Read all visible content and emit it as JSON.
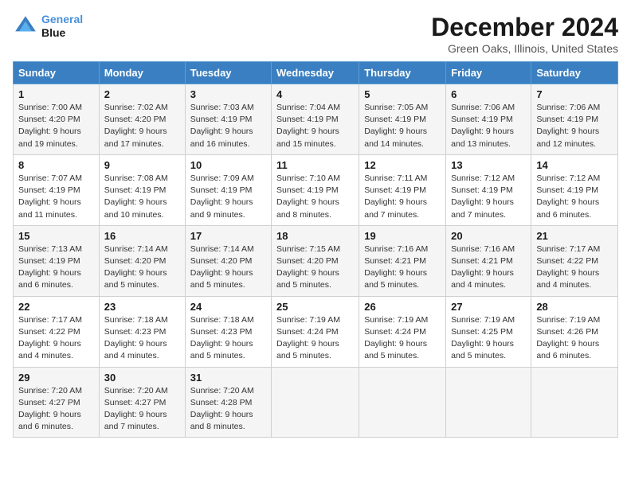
{
  "header": {
    "logo_line1": "General",
    "logo_line2": "Blue",
    "title": "December 2024",
    "subtitle": "Green Oaks, Illinois, United States"
  },
  "days_of_week": [
    "Sunday",
    "Monday",
    "Tuesday",
    "Wednesday",
    "Thursday",
    "Friday",
    "Saturday"
  ],
  "weeks": [
    [
      {
        "day": "1",
        "info": "Sunrise: 7:00 AM\nSunset: 4:20 PM\nDaylight: 9 hours\nand 19 minutes."
      },
      {
        "day": "2",
        "info": "Sunrise: 7:02 AM\nSunset: 4:20 PM\nDaylight: 9 hours\nand 17 minutes."
      },
      {
        "day": "3",
        "info": "Sunrise: 7:03 AM\nSunset: 4:19 PM\nDaylight: 9 hours\nand 16 minutes."
      },
      {
        "day": "4",
        "info": "Sunrise: 7:04 AM\nSunset: 4:19 PM\nDaylight: 9 hours\nand 15 minutes."
      },
      {
        "day": "5",
        "info": "Sunrise: 7:05 AM\nSunset: 4:19 PM\nDaylight: 9 hours\nand 14 minutes."
      },
      {
        "day": "6",
        "info": "Sunrise: 7:06 AM\nSunset: 4:19 PM\nDaylight: 9 hours\nand 13 minutes."
      },
      {
        "day": "7",
        "info": "Sunrise: 7:06 AM\nSunset: 4:19 PM\nDaylight: 9 hours\nand 12 minutes."
      }
    ],
    [
      {
        "day": "8",
        "info": "Sunrise: 7:07 AM\nSunset: 4:19 PM\nDaylight: 9 hours\nand 11 minutes."
      },
      {
        "day": "9",
        "info": "Sunrise: 7:08 AM\nSunset: 4:19 PM\nDaylight: 9 hours\nand 10 minutes."
      },
      {
        "day": "10",
        "info": "Sunrise: 7:09 AM\nSunset: 4:19 PM\nDaylight: 9 hours\nand 9 minutes."
      },
      {
        "day": "11",
        "info": "Sunrise: 7:10 AM\nSunset: 4:19 PM\nDaylight: 9 hours\nand 8 minutes."
      },
      {
        "day": "12",
        "info": "Sunrise: 7:11 AM\nSunset: 4:19 PM\nDaylight: 9 hours\nand 7 minutes."
      },
      {
        "day": "13",
        "info": "Sunrise: 7:12 AM\nSunset: 4:19 PM\nDaylight: 9 hours\nand 7 minutes."
      },
      {
        "day": "14",
        "info": "Sunrise: 7:12 AM\nSunset: 4:19 PM\nDaylight: 9 hours\nand 6 minutes."
      }
    ],
    [
      {
        "day": "15",
        "info": "Sunrise: 7:13 AM\nSunset: 4:19 PM\nDaylight: 9 hours\nand 6 minutes."
      },
      {
        "day": "16",
        "info": "Sunrise: 7:14 AM\nSunset: 4:20 PM\nDaylight: 9 hours\nand 5 minutes."
      },
      {
        "day": "17",
        "info": "Sunrise: 7:14 AM\nSunset: 4:20 PM\nDaylight: 9 hours\nand 5 minutes."
      },
      {
        "day": "18",
        "info": "Sunrise: 7:15 AM\nSunset: 4:20 PM\nDaylight: 9 hours\nand 5 minutes."
      },
      {
        "day": "19",
        "info": "Sunrise: 7:16 AM\nSunset: 4:21 PM\nDaylight: 9 hours\nand 5 minutes."
      },
      {
        "day": "20",
        "info": "Sunrise: 7:16 AM\nSunset: 4:21 PM\nDaylight: 9 hours\nand 4 minutes."
      },
      {
        "day": "21",
        "info": "Sunrise: 7:17 AM\nSunset: 4:22 PM\nDaylight: 9 hours\nand 4 minutes."
      }
    ],
    [
      {
        "day": "22",
        "info": "Sunrise: 7:17 AM\nSunset: 4:22 PM\nDaylight: 9 hours\nand 4 minutes."
      },
      {
        "day": "23",
        "info": "Sunrise: 7:18 AM\nSunset: 4:23 PM\nDaylight: 9 hours\nand 4 minutes."
      },
      {
        "day": "24",
        "info": "Sunrise: 7:18 AM\nSunset: 4:23 PM\nDaylight: 9 hours\nand 5 minutes."
      },
      {
        "day": "25",
        "info": "Sunrise: 7:19 AM\nSunset: 4:24 PM\nDaylight: 9 hours\nand 5 minutes."
      },
      {
        "day": "26",
        "info": "Sunrise: 7:19 AM\nSunset: 4:24 PM\nDaylight: 9 hours\nand 5 minutes."
      },
      {
        "day": "27",
        "info": "Sunrise: 7:19 AM\nSunset: 4:25 PM\nDaylight: 9 hours\nand 5 minutes."
      },
      {
        "day": "28",
        "info": "Sunrise: 7:19 AM\nSunset: 4:26 PM\nDaylight: 9 hours\nand 6 minutes."
      }
    ],
    [
      {
        "day": "29",
        "info": "Sunrise: 7:20 AM\nSunset: 4:27 PM\nDaylight: 9 hours\nand 6 minutes."
      },
      {
        "day": "30",
        "info": "Sunrise: 7:20 AM\nSunset: 4:27 PM\nDaylight: 9 hours\nand 7 minutes."
      },
      {
        "day": "31",
        "info": "Sunrise: 7:20 AM\nSunset: 4:28 PM\nDaylight: 9 hours\nand 8 minutes."
      },
      {
        "day": "",
        "info": ""
      },
      {
        "day": "",
        "info": ""
      },
      {
        "day": "",
        "info": ""
      },
      {
        "day": "",
        "info": ""
      }
    ]
  ]
}
